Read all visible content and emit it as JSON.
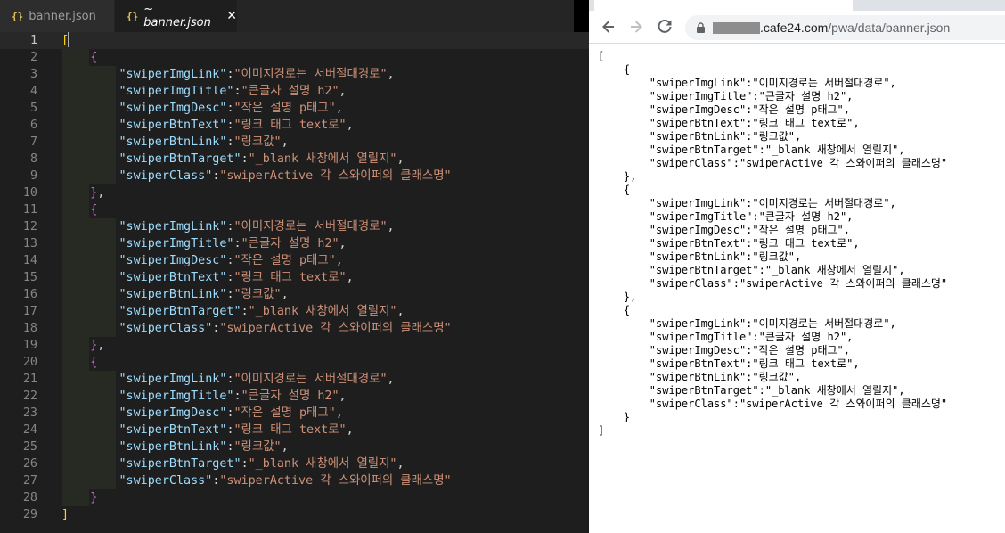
{
  "editor": {
    "tabs": [
      {
        "icon": "{}",
        "label": "banner.json",
        "active": false
      },
      {
        "icon": "{}",
        "label": "~ banner.json",
        "active": true,
        "close": "✕"
      }
    ],
    "lines": [
      "1",
      "2",
      "3",
      "4",
      "5",
      "6",
      "7",
      "8",
      "9",
      "10",
      "11",
      "12",
      "13",
      "14",
      "15",
      "16",
      "17",
      "18",
      "19",
      "20",
      "21",
      "22",
      "23",
      "24",
      "25",
      "26",
      "27",
      "28",
      "29"
    ],
    "entries": [
      {
        "key": "\"swiperImgLink\"",
        "value": "\"이미지경로는 서버절대경로\""
      },
      {
        "key": "\"swiperImgTitle\"",
        "value": "\"큰글자 설명 h2\""
      },
      {
        "key": "\"swiperImgDesc\"",
        "value": "\"작은 설명 p태그\""
      },
      {
        "key": "\"swiperBtnText\"",
        "value": "\"링크 태그 text로\""
      },
      {
        "key": "\"swiperBtnLink\"",
        "value": "\"링크값\""
      },
      {
        "key": "\"swiperBtnTarget\"",
        "value": "\"_blank 새창에서 열릴지\""
      },
      {
        "key": "\"swiperClass\"",
        "value": "\"swiperActive 각 스와이퍼의 클래스명\""
      }
    ],
    "punct": {
      "open_array": "[",
      "close_array": "]",
      "open_obj": "{",
      "close_obj": "}",
      "close_obj_comma": "},",
      "colon": ":",
      "comma": ","
    }
  },
  "browser": {
    "url_host": ".cafe24.com",
    "url_path": "/pwa/data/banner.json",
    "body_text": "[\n    {\n        \"swiperImgLink\":\"이미지경로는 서버절대경로\",\n        \"swiperImgTitle\":\"큰글자 설명 h2\",\n        \"swiperImgDesc\":\"작은 설명 p태그\",\n        \"swiperBtnText\":\"링크 태그 text로\",\n        \"swiperBtnLink\":\"링크값\",\n        \"swiperBtnTarget\":\"_blank 새창에서 열릴지\",\n        \"swiperClass\":\"swiperActive 각 스와이퍼의 클래스명\"\n    },\n    {\n        \"swiperImgLink\":\"이미지경로는 서버절대경로\",\n        \"swiperImgTitle\":\"큰글자 설명 h2\",\n        \"swiperImgDesc\":\"작은 설명 p태그\",\n        \"swiperBtnText\":\"링크 태그 text로\",\n        \"swiperBtnLink\":\"링크값\",\n        \"swiperBtnTarget\":\"_blank 새창에서 열릴지\",\n        \"swiperClass\":\"swiperActive 각 스와이퍼의 클래스명\"\n    },\n    {\n        \"swiperImgLink\":\"이미지경로는 서버절대경로\",\n        \"swiperImgTitle\":\"큰글자 설명 h2\",\n        \"swiperImgDesc\":\"작은 설명 p태그\",\n        \"swiperBtnText\":\"링크 태그 text로\",\n        \"swiperBtnLink\":\"링크값\",\n        \"swiperBtnTarget\":\"_blank 새창에서 열릴지\",\n        \"swiperClass\":\"swiperActive 각 스와이퍼의 클래스명\"\n    }\n]"
  },
  "colors": {
    "editor_bg": "#1e1e1e",
    "json_key": "#9cdcfe",
    "json_string": "#ce9178",
    "bracket_gold": "#ffd700",
    "bracket_purple": "#da70d6"
  }
}
